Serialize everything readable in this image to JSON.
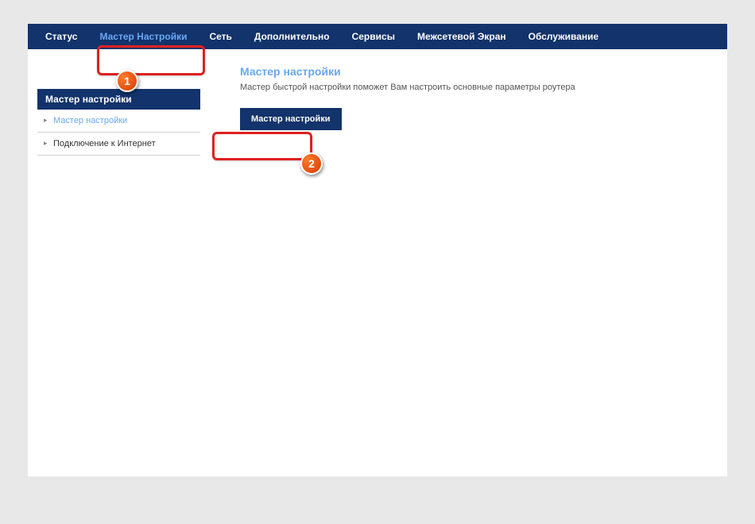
{
  "nav": {
    "items": [
      {
        "label": "Статус"
      },
      {
        "label": "Мастер Настройки"
      },
      {
        "label": "Сеть"
      },
      {
        "label": "Дополнительно"
      },
      {
        "label": "Сервисы"
      },
      {
        "label": "Межсетевой Экран"
      },
      {
        "label": "Обслуживание"
      }
    ]
  },
  "sidebar": {
    "header": "Мастер настройки",
    "items": [
      {
        "label": "Мастер настройки"
      },
      {
        "label": "Подключение к Интернет"
      }
    ]
  },
  "main": {
    "title": "Мастер настройки",
    "desc": "Мастер быстрой настройки поможет Вам настроить основные параметры роутера",
    "button_label": "Мастер настройки"
  },
  "annotations": {
    "badge1": "1",
    "badge2": "2"
  }
}
